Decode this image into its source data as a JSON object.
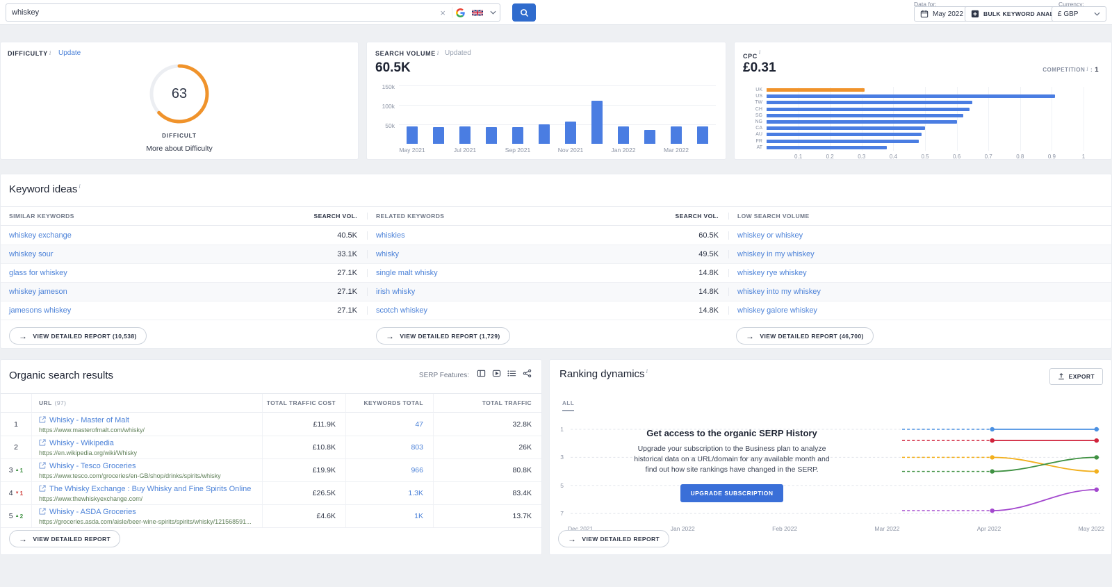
{
  "topbar": {
    "search_value": "whiskey",
    "data_for_label": "Data for:",
    "date_value": "May 2022",
    "bulk_label": "BULK KEYWORD ANALYSIS",
    "currency_label": "Currency:",
    "currency_value": "£ GBP"
  },
  "difficulty": {
    "title": "DIFFICULTY",
    "update_label": "Update",
    "value": "63",
    "level": "DIFFICULT",
    "more_label": "More about Difficulty",
    "ring_color": "#f0932b"
  },
  "search_volume": {
    "title": "SEARCH VOLUME",
    "updated_label": "Updated",
    "value": "60.5K",
    "chart_data": {
      "type": "bar",
      "categories": [
        "May 2021",
        "Jun 2021",
        "Jul 2021",
        "Aug 2021",
        "Sep 2021",
        "Oct 2021",
        "Nov 2021",
        "Dec 2021",
        "Jan 2022",
        "Feb 2022",
        "Mar 2022",
        "Apr 2022"
      ],
      "values": [
        45000,
        42000,
        44000,
        42000,
        43000,
        50000,
        58000,
        110000,
        44000,
        35000,
        44000,
        45000
      ],
      "ylim": [
        0,
        150000
      ],
      "yticks": [
        "50k",
        "100k",
        "150k"
      ],
      "xtick_labels": [
        "May 2021",
        "Jul 2021",
        "Sep 2021",
        "Nov 2021",
        "Jan 2022",
        "Mar 2022"
      ],
      "bar_color": "#4a7de2"
    }
  },
  "cpc": {
    "title": "CPC",
    "value": "£0.31",
    "competition_label": "COMPETITION",
    "competition_value": "1",
    "chart_data": {
      "type": "bar",
      "orientation": "horizontal",
      "categories": [
        "UK",
        "US",
        "TW",
        "CH",
        "SG",
        "NG",
        "CA",
        "AU",
        "FR",
        "AT"
      ],
      "values": [
        0.31,
        0.91,
        0.65,
        0.64,
        0.62,
        0.6,
        0.5,
        0.49,
        0.48,
        0.38
      ],
      "xticks": [
        "0.1",
        "0.2",
        "0.3",
        "0.4",
        "0.5",
        "0.6",
        "0.7",
        "0.8",
        "0.9",
        "1"
      ],
      "xlim": [
        0,
        1
      ],
      "bar_color": "#4a7de2",
      "highlight_category": "UK",
      "highlight_color": "#f0932b"
    }
  },
  "keyword_ideas": {
    "title": "Keyword ideas",
    "col_similar": "SIMILAR KEYWORDS",
    "col_search_vol_1": "SEARCH VOL.",
    "col_related": "RELATED KEYWORDS",
    "col_search_vol_2": "SEARCH VOL.",
    "col_low": "LOW SEARCH VOLUME",
    "similar_keywords": [
      {
        "keyword": "whiskey exchange",
        "volume": "40.5K"
      },
      {
        "keyword": "whiskey sour",
        "volume": "33.1K"
      },
      {
        "keyword": "glass for whiskey",
        "volume": "27.1K"
      },
      {
        "keyword": "whiskey jameson",
        "volume": "27.1K"
      },
      {
        "keyword": "jamesons whiskey",
        "volume": "27.1K"
      }
    ],
    "related_keywords": [
      {
        "keyword": "whiskies",
        "volume": "60.5K"
      },
      {
        "keyword": "whisky",
        "volume": "49.5K"
      },
      {
        "keyword": "single malt whisky",
        "volume": "14.8K"
      },
      {
        "keyword": "irish whisky",
        "volume": "14.8K"
      },
      {
        "keyword": "scotch whiskey",
        "volume": "14.8K"
      }
    ],
    "low_volume_keywords": [
      "whiskey or whiskey",
      "whiskey in my whiskey",
      "whiskey rye whiskey",
      "whiskey into my whiskey",
      "whiskey galore whiskey"
    ],
    "report_similar": "VIEW DETAILED REPORT (10,538)",
    "report_related": "VIEW DETAILED REPORT (1,729)",
    "report_low": "VIEW DETAILED REPORT (46,700)"
  },
  "organic": {
    "title": "Organic search results",
    "serp_features_label": "SERP Features:",
    "col_url": "URL",
    "col_url_count": "(97)",
    "col_cost": "TOTAL TRAFFIC COST",
    "col_keywords": "KEYWORDS TOTAL",
    "col_traffic": "TOTAL TRAFFIC",
    "rows": [
      {
        "rank": "1",
        "change": "",
        "direction": "",
        "title": "Whisky - Master of Malt",
        "url": "https://www.masterofmalt.com/whisky/",
        "cost": "£11.9K",
        "keywords": "47",
        "traffic": "32.8K"
      },
      {
        "rank": "2",
        "change": "",
        "direction": "",
        "title": "Whisky - Wikipedia",
        "url": "https://en.wikipedia.org/wiki/Whisky",
        "cost": "£10.8K",
        "keywords": "803",
        "traffic": "26K"
      },
      {
        "rank": "3",
        "change": "1",
        "direction": "up",
        "title": "Whisky - Tesco Groceries",
        "url": "https://www.tesco.com/groceries/en-GB/shop/drinks/spirits/whisky",
        "cost": "£19.9K",
        "keywords": "966",
        "traffic": "80.8K"
      },
      {
        "rank": "4",
        "change": "1",
        "direction": "down",
        "title": "The Whisky Exchange : Buy Whisky and Fine Spirits Online",
        "url": "https://www.thewhiskyexchange.com/",
        "cost": "£26.5K",
        "keywords": "1.3K",
        "traffic": "83.4K"
      },
      {
        "rank": "5",
        "change": "2",
        "direction": "up",
        "title": "Whisky - ASDA Groceries",
        "url": "https://groceries.asda.com/aisle/beer-wine-spirits/spirits/whisky/121568591...",
        "cost": "£4.6K",
        "keywords": "1K",
        "traffic": "13.7K"
      }
    ],
    "report_label": "VIEW DETAILED REPORT"
  },
  "ranking": {
    "title": "Ranking dynamics",
    "export_label": "EXPORT",
    "tab_all": "ALL",
    "overlay_title": "Get access to the organic SERP History",
    "overlay_text": "Upgrade your subscription to the Business plan to analyze historical data on a URL/domain for any available month and find out how site rankings have changed in the SERP.",
    "upgrade_label": "UPGRADE SUBSCRIPTION",
    "report_label": "VIEW DETAILED REPORT",
    "chart_data": {
      "type": "line",
      "x_labels": [
        "Dec 2021",
        "Jan 2022",
        "Feb 2022",
        "Mar 2022",
        "Apr 2022",
        "May 2022"
      ],
      "x_visible": [
        "Apr 2022",
        "May 2022"
      ],
      "y_ticks": [
        "1",
        "3",
        "5",
        "7"
      ],
      "y_axis_inverted": true,
      "series": [
        {
          "name": "line-blue",
          "color": "#4a90e2",
          "values": [
            1,
            1
          ]
        },
        {
          "name": "line-red",
          "color": "#d0243c",
          "values": [
            1.8,
            1.8
          ]
        },
        {
          "name": "line-yellow",
          "color": "#f2b01e",
          "values": [
            3,
            4
          ]
        },
        {
          "name": "line-green",
          "color": "#3f9142",
          "values": [
            4,
            3
          ]
        },
        {
          "name": "line-purple",
          "color": "#a348ce",
          "values": [
            6.8,
            5.3
          ]
        }
      ]
    }
  }
}
